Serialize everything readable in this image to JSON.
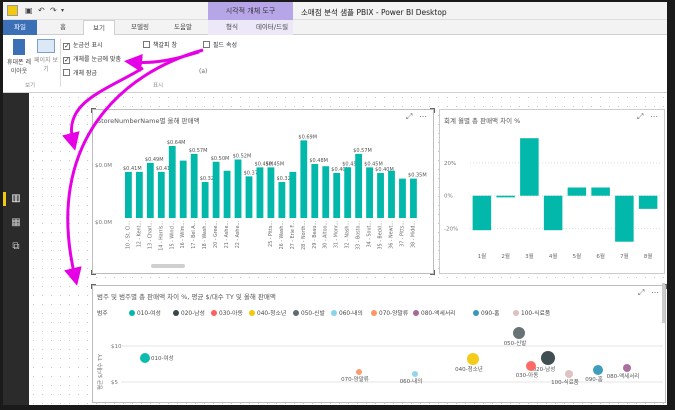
{
  "window": {
    "title": "소매점 분석 샘플 PBIX - Power BI Desktop",
    "context_band": "시각적 개체 도구"
  },
  "tabs": [
    "파일",
    "홈",
    "보기",
    "모델링",
    "도움말",
    "형식",
    "데이터/드릴"
  ],
  "ribbon": {
    "phone_layout": "휴대폰 레이아웃",
    "page_view": "페이지 보기",
    "show_gridlines": "눈금선 표시",
    "snap_to_grid": "개체를 눈금에 맞춤",
    "lock_objects": "개체 잠금",
    "bookmarks_pane": "책갈피 창",
    "field_properties": "필드 속성",
    "selection_suffix": "(a)",
    "group_view": "보기",
    "group_show": "표시",
    "checks": {
      "show_gridlines": true,
      "snap_to_grid": true,
      "lock_objects": false,
      "bookmarks_pane": false,
      "field_properties": false
    }
  },
  "bar_visual": {
    "title": "StoreNumberName별 올해 판매액",
    "ytick_top": "$0.0M",
    "ytick_bottom": "$0.0M"
  },
  "variance_visual": {
    "title": "회계 월별 총 판매액 차이 %"
  },
  "scatter_visual": {
    "title": "범주 및 범주별 총 판매액 차이 %, 평균 $/대수 TY 및 올해 판매액",
    "legend_label": "범주",
    "ylabel": "평균 $/대수 TY",
    "yticks": [
      "$10",
      "$5"
    ]
  },
  "colors": {
    "accent": "#01b8aa",
    "powerbi_yellow": "#f2c811",
    "arrow": "#e600e6",
    "context": "#b6a6e8"
  },
  "chart_data": [
    {
      "type": "bar",
      "title": "StoreNumberName별 올해 판매액",
      "categories": [
        "10 - St. Cl...",
        "12 - Kent...",
        "13 - Charl...",
        "14 - Harris...",
        "15 - Wincl...",
        "16 - Wilm...",
        "17 - Bel A...",
        "18 - Wash...",
        "20 - Gree...",
        "21 - Ashe...",
        "22 - Ashe...",
        "23 - Ashe...",
        "24 - Cleve...",
        "25 - Pitts...",
        "26 - Wash...",
        "27 - Erie F...",
        "28 - North...",
        "29 - Beau...",
        "30 - Altoo...",
        "31 - Monr...",
        "32 - Nash...",
        "33 - Bosto...",
        "34 - Sout...",
        "35 - Beckl...",
        "36 - Newt...",
        "37 - Pitts...",
        "38 - Midd..."
      ],
      "values": [
        0.41,
        0.41,
        0.49,
        0.41,
        0.64,
        0.51,
        0.57,
        0.32,
        0.5,
        0.42,
        0.52,
        0.37,
        0.45,
        0.45,
        0.32,
        0.41,
        0.69,
        0.48,
        0.46,
        0.4,
        0.45,
        0.57,
        0.45,
        0.4,
        0.42,
        0.35,
        0.35
      ],
      "labels": {
        "0": "$0.41M",
        "2": "$0.49M",
        "3": "$0.41M",
        "4": "$0.64M",
        "6": "$0.57M",
        "7": "$0.32M",
        "8": "$0.50M",
        "10": "$0.52M",
        "11": "$0.37M",
        "12": "$0.45M",
        "13": "$0.45M",
        "14": "$0.32M",
        "16": "$0.69M",
        "17": "$0.48M",
        "19": "$0.40M",
        "20": "$0.45M",
        "21": "$0.57M",
        "22": "$0.45M",
        "23": "$0.40M",
        "26": "$0.35M"
      },
      "xtick_labels_shown": [
        "10 - St. Cl...",
        "12 - Kent...",
        "13 - Charl...",
        "14 - Harris...",
        "15 - Wincl...",
        "16 - Wilm...",
        "17 - Bel A...",
        "18 - Wash...",
        "20 - Gree...",
        "21 - Ashe...",
        "22 - Ashe...",
        "25 - Pitts...",
        "26 - Wash...",
        "27 - Erie F...",
        "28 - North...",
        "29 - Beau...",
        "30 - Altoo...",
        "31 - Monr...",
        "32 - Nash...",
        "33 - Bosto...",
        "34 - Sout...",
        "35 - Beckl...",
        "36 - Newt...",
        "37 - Pitts...",
        "38 - Midd..."
      ],
      "yunit": "$M",
      "color": "#01b8aa"
    },
    {
      "type": "bar",
      "title": "회계 월별 총 판매액 차이 %",
      "categories": [
        "1월",
        "2월",
        "3월",
        "4월",
        "5월",
        "6월",
        "7월",
        "8월"
      ],
      "values": [
        -21,
        -1,
        35,
        -21,
        5,
        5,
        -28,
        -8
      ],
      "yticks": [
        "20%",
        "0%",
        "-20%"
      ],
      "ylim": [
        -30,
        40
      ],
      "color": "#01b8aa"
    },
    {
      "type": "scatter",
      "title": "범주 및 범주별 총 판매액 차이 %, 평균 $/대수 TY 및 올해 판매액",
      "ylabel": "평균 $/대수 TY",
      "yticks": [
        "$10",
        "$5"
      ],
      "series": [
        {
          "name": "010-여성",
          "color": "#01b8aa"
        },
        {
          "name": "020-남성",
          "color": "#374649"
        },
        {
          "name": "030-아동",
          "color": "#fd625e"
        },
        {
          "name": "040-청소년",
          "color": "#f2c80f"
        },
        {
          "name": "050-신발",
          "color": "#5f6b6d"
        },
        {
          "name": "060-내의",
          "color": "#8ad4eb"
        },
        {
          "name": "070-양말류",
          "color": "#fe9666"
        },
        {
          "name": "080-액세서리",
          "color": "#a66999"
        },
        {
          "name": "090-홈",
          "color": "#3599b8"
        },
        {
          "name": "100-식료품",
          "color": "#dfbfbf"
        }
      ],
      "points": [
        {
          "label": "010-여성",
          "series": "010-여성",
          "size": 5
        },
        {
          "label": "020-남성",
          "series": "020-남성",
          "size": 7
        },
        {
          "label": "030-아동",
          "series": "030-아동",
          "size": 5
        },
        {
          "label": "040-청소년",
          "series": "040-청소년",
          "size": 6
        },
        {
          "label": "050-신발",
          "series": "050-신발",
          "size": 6
        },
        {
          "label": "060-내의",
          "series": "060-내의",
          "size": 3
        },
        {
          "label": "070-양말류",
          "series": "070-양말류",
          "size": 3
        },
        {
          "label": "080-액세서리",
          "series": "080-액세서리",
          "size": 4
        },
        {
          "label": "090-홈",
          "series": "090-홈",
          "size": 5
        },
        {
          "label": "100-식료품",
          "series": "100-식료품",
          "size": 4
        }
      ]
    }
  ]
}
